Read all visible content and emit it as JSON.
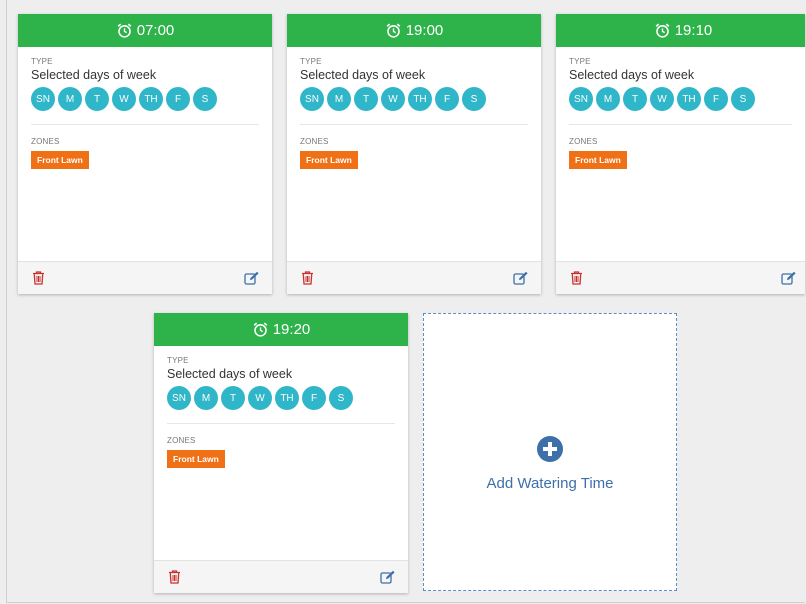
{
  "colors": {
    "header_green": "#2eb34b",
    "day_teal": "#2fb6c9",
    "zone_orange": "#f07016",
    "delete_red": "#c9302c",
    "edit_blue": "#3d6fa8"
  },
  "schedules": [
    {
      "time": "07:00",
      "type_label": "TYPE",
      "type_value": "Selected days of week",
      "days": [
        "SN",
        "M",
        "T",
        "W",
        "TH",
        "F",
        "S"
      ],
      "zones_label": "ZONES",
      "zones": [
        "Front Lawn"
      ],
      "icons": {
        "time": "alarm-clock-icon",
        "delete": "trash-icon",
        "edit": "edit-icon"
      }
    },
    {
      "time": "19:00",
      "type_label": "TYPE",
      "type_value": "Selected days of week",
      "days": [
        "SN",
        "M",
        "T",
        "W",
        "TH",
        "F",
        "S"
      ],
      "zones_label": "ZONES",
      "zones": [
        "Front Lawn"
      ],
      "icons": {
        "time": "alarm-clock-icon",
        "delete": "trash-icon",
        "edit": "edit-icon"
      }
    },
    {
      "time": "19:10",
      "type_label": "TYPE",
      "type_value": "Selected days of week",
      "days": [
        "SN",
        "M",
        "T",
        "W",
        "TH",
        "F",
        "S"
      ],
      "zones_label": "ZONES",
      "zones": [
        "Front Lawn"
      ],
      "icons": {
        "time": "alarm-clock-icon",
        "delete": "trash-icon",
        "edit": "edit-icon"
      }
    },
    {
      "time": "19:20",
      "type_label": "TYPE",
      "type_value": "Selected days of week",
      "days": [
        "SN",
        "M",
        "T",
        "W",
        "TH",
        "F",
        "S"
      ],
      "zones_label": "ZONES",
      "zones": [
        "Front Lawn"
      ],
      "icons": {
        "time": "alarm-clock-icon",
        "delete": "trash-icon",
        "edit": "edit-icon"
      }
    }
  ],
  "add_card": {
    "label": "Add Watering Time",
    "icon": "plus-circle-icon"
  }
}
